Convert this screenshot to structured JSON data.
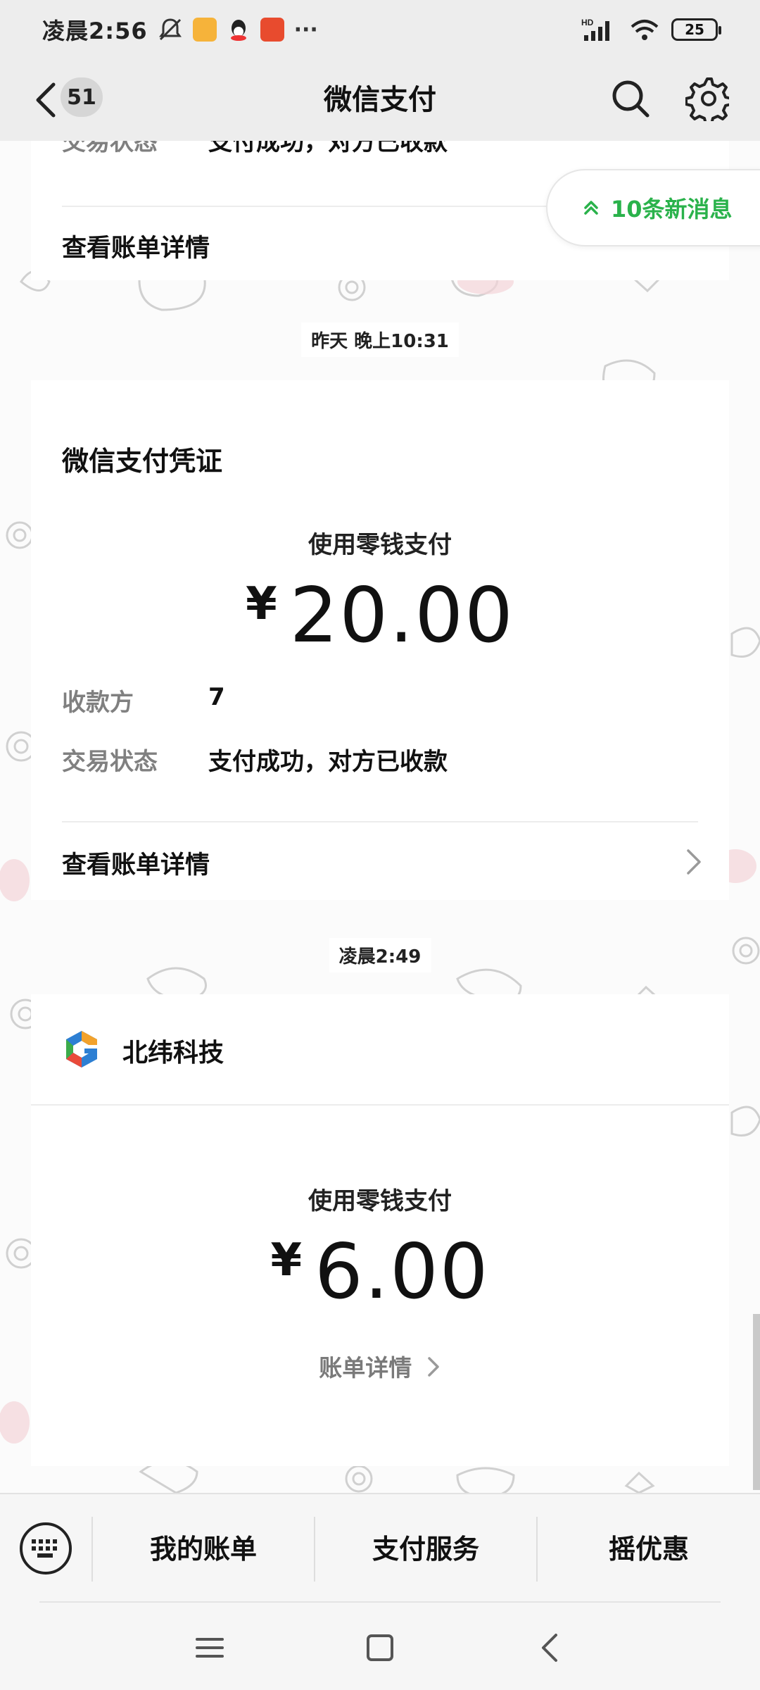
{
  "status_bar": {
    "time": "凌晨2:56",
    "network": "HD",
    "battery": "25"
  },
  "nav": {
    "unread_count": "51",
    "title": "微信支付"
  },
  "new_messages": {
    "label": "10条新消息"
  },
  "top_partial_card": {
    "status_label": "交易状态",
    "status_value": "支付成功，对方已收款",
    "details_link": "查看账单详情"
  },
  "timestamps": {
    "first": "昨天 晚上10:31",
    "second": "凌晨2:49"
  },
  "voucher_card": {
    "title": "微信支付凭证",
    "method": "使用零钱支付",
    "currency": "¥",
    "amount": "20.00",
    "payee_label": "收款方",
    "payee_value": "7",
    "status_label": "交易状态",
    "status_value": "支付成功，对方已收款",
    "details_link": "查看账单详情"
  },
  "merchant_card": {
    "merchant_name": "北纬科技",
    "method": "使用零钱支付",
    "currency": "¥",
    "amount": "6.00",
    "details_link": "账单详情"
  },
  "bottom_menu": {
    "items": [
      "我的账单",
      "支付服务",
      "摇优惠"
    ]
  },
  "colors": {
    "accent_green": "#2ab24b",
    "card_bg": "#ffffff",
    "bar_bg": "#ededed"
  },
  "icons": [
    "back-arrow-icon",
    "search-icon",
    "gear-icon",
    "keyboard-icon",
    "menu-icon",
    "home-icon",
    "nav-back-icon",
    "double-chevron-up-icon",
    "chevron-right-icon",
    "merchant-logo-icon"
  ]
}
